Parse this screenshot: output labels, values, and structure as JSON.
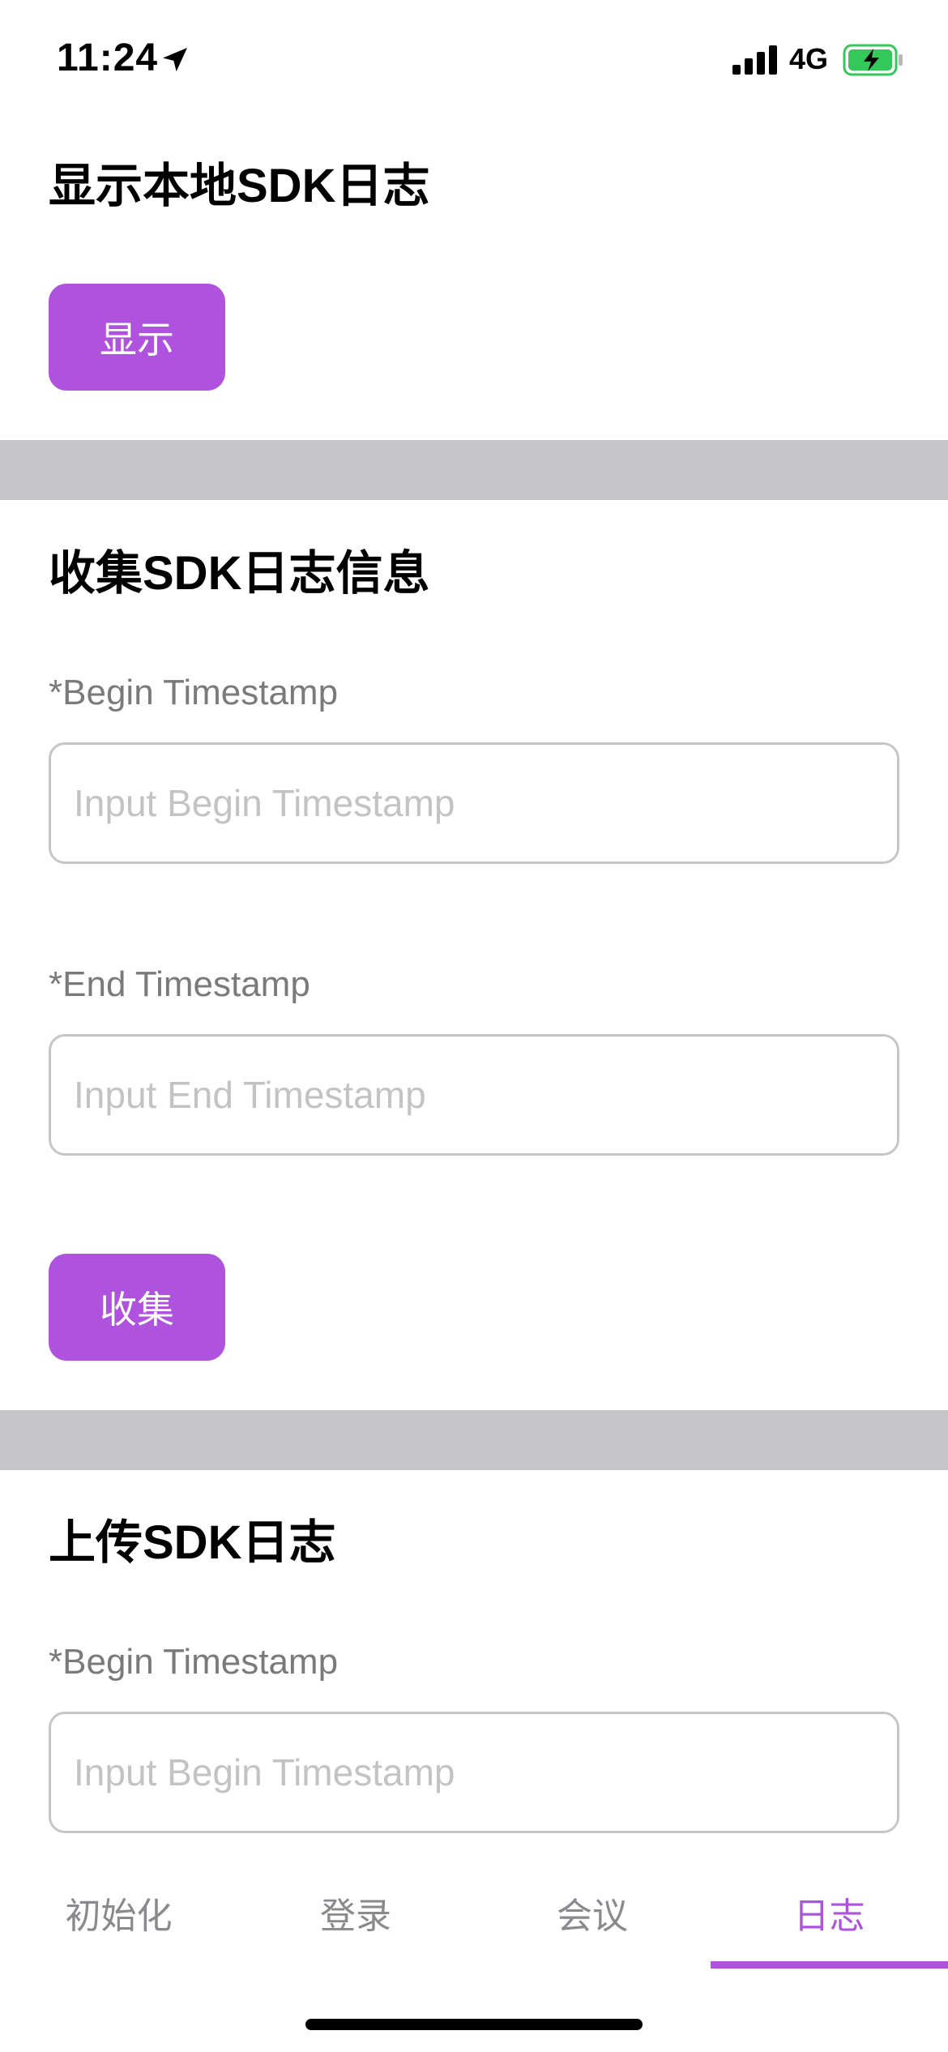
{
  "status_bar": {
    "time": "11:24",
    "network": "4G",
    "location_icon": "location-arrow-icon",
    "signal_icon": "cellular-signal-icon",
    "battery_icon": "battery-charging-icon",
    "battery_color": "#34c759"
  },
  "accent_color": "#af52de",
  "section_show": {
    "title": "显示本地SDK日志",
    "button_label": "显示"
  },
  "section_collect": {
    "title": "收集SDK日志信息",
    "begin_label": "*Begin Timestamp",
    "begin_placeholder": "Input Begin Timestamp",
    "begin_value": "",
    "end_label": "*End Timestamp",
    "end_placeholder": "Input End Timestamp",
    "end_value": "",
    "button_label": "收集"
  },
  "section_upload": {
    "title": "上传SDK日志",
    "begin_label": "*Begin Timestamp",
    "begin_placeholder": "Input Begin Timestamp",
    "begin_value": ""
  },
  "tab_bar": {
    "tabs": [
      {
        "label": "初始化",
        "active": false
      },
      {
        "label": "登录",
        "active": false
      },
      {
        "label": "会议",
        "active": false
      },
      {
        "label": "日志",
        "active": true
      }
    ]
  }
}
